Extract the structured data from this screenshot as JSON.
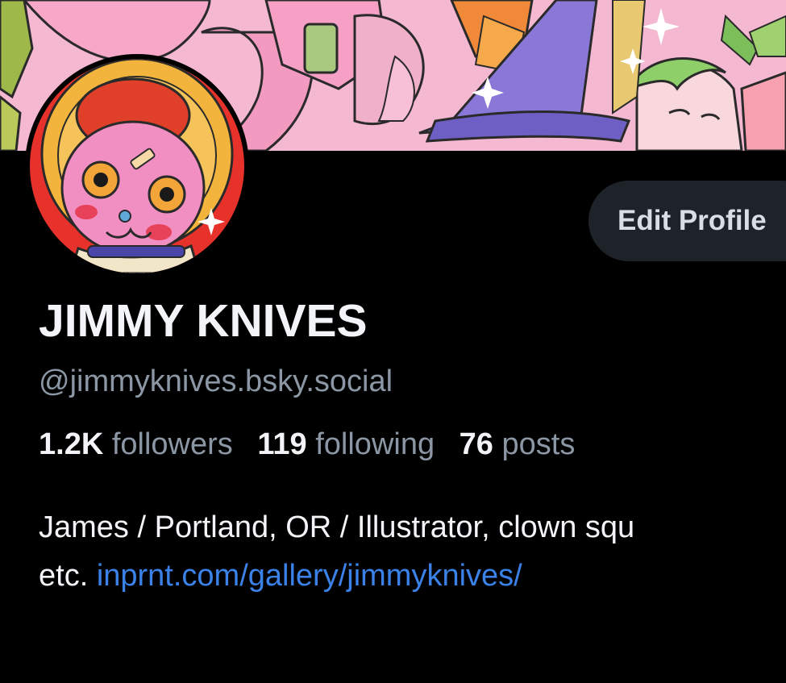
{
  "profile": {
    "display_name": "JIMMY KNIVES",
    "handle": "@jimmyknives.bsky.social",
    "edit_button_label": "Edit Profile",
    "stats": {
      "followers_count": "1.2K",
      "followers_label": "followers",
      "following_count": "119",
      "following_label": "following",
      "posts_count": "76",
      "posts_label": "posts"
    },
    "bio": {
      "line1": "James / Portland, OR / Illustrator, clown squ",
      "line2_prefix": "etc.",
      "link_text": "inprnt.com/gallery/jimmyknives/"
    }
  },
  "colors": {
    "background": "#000000",
    "text_primary": "#f2f4f7",
    "text_secondary": "#8c97a5",
    "link": "#3b82e8",
    "button_bg": "#1e2329"
  },
  "icons": {
    "banner": "illustrated-banner-art",
    "avatar": "cartoon-character-avatar"
  }
}
